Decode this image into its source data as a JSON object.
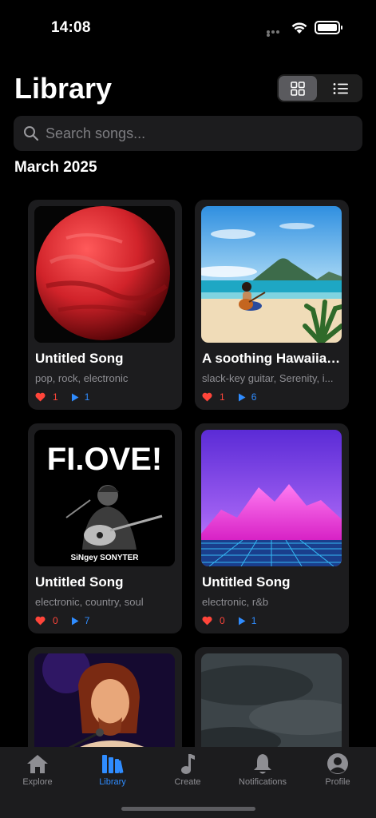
{
  "status_bar": {
    "time": "14:08"
  },
  "header": {
    "title": "Library",
    "view_modes": [
      "grid",
      "list"
    ],
    "active_view": "grid"
  },
  "search": {
    "placeholder": "Search songs..."
  },
  "section": {
    "title": "March 2025"
  },
  "songs": [
    {
      "title": "Untitled Song",
      "tags": "pop, rock, electronic",
      "likes": "1",
      "plays": "1",
      "art": "red-planet"
    },
    {
      "title": "A soothing Hawaiian...",
      "tags": "slack-key guitar, Serenity, i...",
      "likes": "1",
      "plays": "6",
      "art": "beach-guitarist"
    },
    {
      "title": "Untitled Song",
      "tags": "electronic, country, soul",
      "likes": "0",
      "plays": "7",
      "art": "flove-poster",
      "art_text": {
        "headline": "FI.OVE!",
        "footer": "SiNgey SONYTER"
      }
    },
    {
      "title": "Untitled Song",
      "tags": "electronic, r&b",
      "likes": "0",
      "plays": "1",
      "art": "synthwave-mountains"
    },
    {
      "title": "",
      "tags": "",
      "likes": "",
      "plays": "",
      "art": "singer-portrait"
    },
    {
      "title": "",
      "tags": "",
      "likes": "",
      "plays": "",
      "art": "stormy-clouds"
    }
  ],
  "tab_bar": {
    "active": "Library",
    "tabs": [
      {
        "label": "Explore",
        "icon": "house-icon"
      },
      {
        "label": "Library",
        "icon": "books-icon"
      },
      {
        "label": "Create",
        "icon": "music-note-icon"
      },
      {
        "label": "Notifications",
        "icon": "bell-icon"
      },
      {
        "label": "Profile",
        "icon": "person-circle-icon"
      }
    ]
  },
  "colors": {
    "background": "#000000",
    "card": "#1c1c1e",
    "accent": "#2f8cff",
    "like": "#ff453a",
    "muted_text": "#8e8e93"
  }
}
